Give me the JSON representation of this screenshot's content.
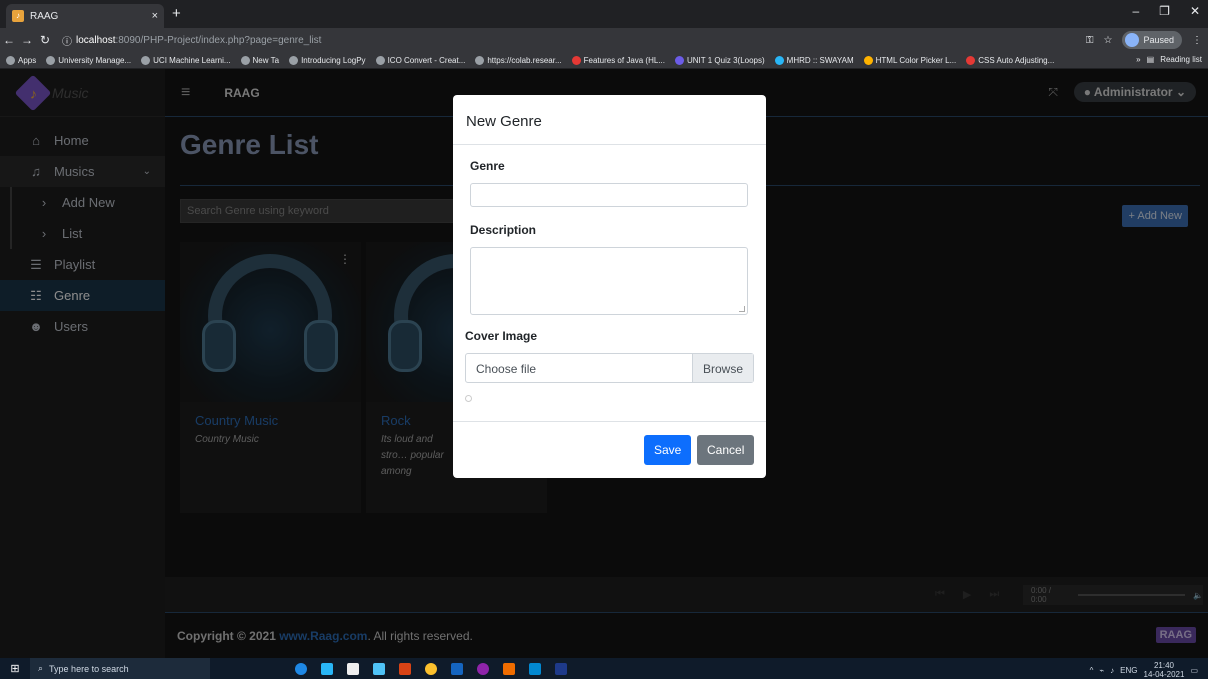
{
  "browser": {
    "tab_title": "RAAG",
    "tab_close": "×",
    "new_tab": "+",
    "window_controls": [
      "–",
      "❐",
      "✕"
    ],
    "url_host": "localhost",
    "url_path": ":8090/PHP-Project/index.php?page=genre_list",
    "profile_status": "Paused",
    "bookmarks": [
      "Apps",
      "University Manage...",
      "UCI Machine Learni...",
      "New Ta",
      "Introducing LogPy",
      "ICO Convert - Creat...",
      "https://colab.resear...",
      "Features of Java (HL...",
      "UNIT 1 Quiz 3(Loops)",
      "MHRD :: SWAYAM",
      "HTML Color Picker L...",
      "CSS Auto Adjusting..."
    ],
    "reading_list": "Reading list"
  },
  "sidebar": {
    "brand": "Music",
    "items": [
      {
        "label": "Home",
        "icon": "home-icon"
      },
      {
        "label": "Musics",
        "icon": "music-icon"
      },
      {
        "label": "Add New",
        "icon": "chevron-right-icon"
      },
      {
        "label": "List",
        "icon": "chevron-right-icon"
      },
      {
        "label": "Playlist",
        "icon": "list-icon"
      },
      {
        "label": "Genre",
        "icon": "th-list-icon"
      },
      {
        "label": "Users",
        "icon": "users-icon"
      }
    ]
  },
  "topbar": {
    "app_name": "RAAG",
    "user": "Administrator"
  },
  "page": {
    "title": "Genre List",
    "search_placeholder": "Search Genre using keyword",
    "add_button": "+ Add New",
    "cards": [
      {
        "title": "Country Music",
        "description": "Country Music"
      },
      {
        "title": "Rock",
        "description": "Its loud and stro… popular among"
      }
    ]
  },
  "player": {
    "time": "0:00 / 0:00"
  },
  "footer": {
    "copyright": "Copyright © 2021 ",
    "link": "www.Raag.com",
    "rest": ". All rights reserved.",
    "logo": "RAAG"
  },
  "modal": {
    "title": "New Genre",
    "genre_label": "Genre",
    "genre_value": "",
    "description_label": "Description",
    "description_value": "",
    "cover_label": "Cover Image",
    "file_placeholder": "Choose file",
    "browse_label": "Browse",
    "save_label": "Save",
    "cancel_label": "Cancel"
  },
  "taskbar": {
    "search_placeholder": "Type here to search",
    "lang": "ENG",
    "time": "21:40",
    "date": "14-04-2021"
  },
  "colors": {
    "primary": "#0d6efd",
    "secondary": "#6c757d",
    "accent": "#2d6db8"
  }
}
